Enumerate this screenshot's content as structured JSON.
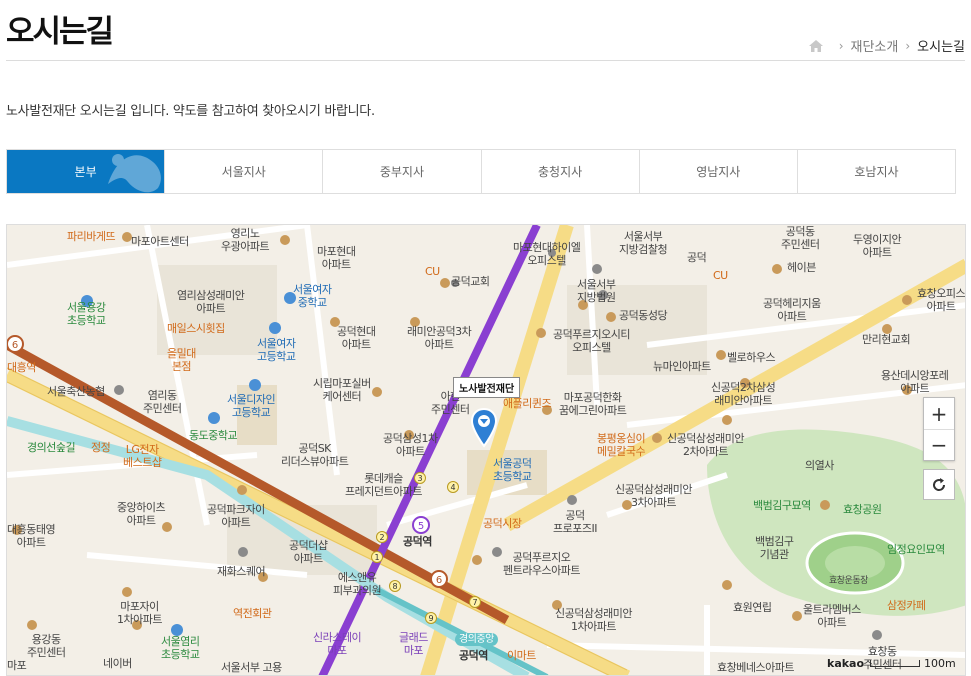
{
  "page": {
    "title": "오시는길",
    "intro": "노사발전재단 오시는길 입니다. 약도를 참고하여 찾아오시기 바랍니다."
  },
  "breadcrumb": {
    "home_icon": "home-icon",
    "items": [
      "재단소개",
      "오시는길"
    ]
  },
  "tabs": [
    {
      "label": "본부",
      "active": true
    },
    {
      "label": "서울지사",
      "active": false
    },
    {
      "label": "중부지사",
      "active": false
    },
    {
      "label": "충청지사",
      "active": false
    },
    {
      "label": "영남지사",
      "active": false
    },
    {
      "label": "호남지사",
      "active": false
    }
  ],
  "colors": {
    "tab_active": "#0a78c2",
    "line5": "#8a3fd1",
    "line6": "#b5592a",
    "gyeongui": "#65c3c8",
    "road_major": "#f5d77a",
    "park": "#c9e3b8"
  },
  "map": {
    "marker_label": "노사발전재단",
    "zoom_in": "+",
    "zoom_out": "−",
    "attribution": "kakao",
    "scale": "100m",
    "labels": {
      "l1": "파리바게뜨",
      "l2": "마포아트센터",
      "l3": "영리노\n우광아파트",
      "l4": "마포현대\n아파트",
      "l5": "마포현대하이엘\n오피스텔",
      "l6": "서울서부\n지방검찰청",
      "l7": "공덕동\n주민센터",
      "l8": "두영이지안\n아파트",
      "l9": "서울용강\n초등학교",
      "l10": "염리삼성래미안\n아파트",
      "l11": "서울여자\n중학교",
      "l12": "공덕교회",
      "l13": "서울서부\n지방법원",
      "l14": "공덕동성당",
      "l15": "공덕",
      "l16": "헤이븐",
      "l17": "효창오피스\n아파트",
      "l18": "매일스시횟집",
      "l19": "서울여자\n고등학교",
      "l20": "공덕현대\n아파트",
      "l21": "래미안공덕3차\n아파트",
      "l22": "공덕푸르지오시티\n오피스텔",
      "l23": "공덕헤리지움\n아파트",
      "l24": "만리현교회",
      "l25": "을밀대\n본점",
      "l26": "뉴마인아파트",
      "l27": "벨로하우스",
      "l28": "용산데시앙포레\n아파트",
      "l29": "대흥역",
      "l30": "서울축산농협",
      "l31": "염리동\n주민센터",
      "l32": "시립마포실버\n케어센터",
      "l33": "아현\n주민센터",
      "l34": "애플리퀸즈",
      "l35": "마포공덕한화\n꿈에그린아파트",
      "l36": "신공덕2차삼성\n래미안아파트",
      "l37": "서울디자인\n고등학교",
      "l38": "동도중학교",
      "l39": "경의선숲길",
      "l40": "정정",
      "l41": "LG전자\n베스트샵",
      "l42": "공덕삼성1차\n아파트",
      "l43": "서울공덕\n초등학교",
      "l44": "봉평옹심이\n메밀칼국수",
      "l45": "신공덕삼성래미안\n2차아파트",
      "l46": "공덕SK\n리더스뷰아파트",
      "l47": "롯데캐슬\n프레지던트아파트",
      "l48": "의열사",
      "l49": "중앙하이츠\n아파트",
      "l50": "공덕파크자이\n아파트",
      "l51": "공덕시장",
      "l52": "신공덕삼성래미안\n3차아파트",
      "l53": "백범김구묘역",
      "l54": "효창공원",
      "l55": "공덕\n프로포즈II",
      "l56": "대흥동태영\n아파트",
      "l57": "공덕역",
      "l58": "공덕더샵\n아파트",
      "l59": "백범김구\n기념관",
      "l60": "임정요인묘역",
      "l61": "재화스퀘어",
      "l62": "공덕푸르지오\n펜트라우스아파트",
      "l63": "에스앤유\n피부과의원",
      "l64": "효창운동장",
      "l65": "마포자이\n1차아파트",
      "l66": "역전회관",
      "l67": "효원연립",
      "l68": "울트라멤버스\n아파트",
      "l69": "삼정카페",
      "l70": "신공덕삼성래미안\n1차아파트",
      "l71": "용강동\n주민센터",
      "l72": "서울염리\n초등학교",
      "l73": "신라스테이\n마포",
      "l74": "글래드\n마포",
      "l75": "공덕역",
      "l76": "이마트",
      "l77": "효창동\n주민센터",
      "l78": "네이버",
      "l79": "서울서부 고용",
      "l80": "효창베네스아파트",
      "l81": "마포",
      "l82": "경의중앙",
      "l83": "CU",
      "l84": "CU"
    }
  }
}
